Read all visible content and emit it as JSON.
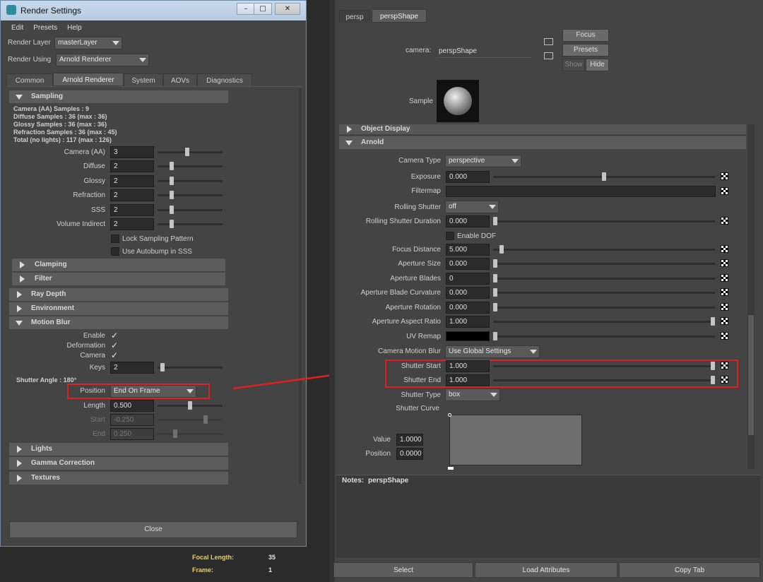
{
  "render_settings": {
    "title": "Render Settings",
    "menu": [
      "Edit",
      "Presets",
      "Help"
    ],
    "render_layer_label": "Render Layer",
    "render_layer_value": "masterLayer",
    "render_using_label": "Render Using",
    "render_using_value": "Arnold Renderer",
    "tabs": [
      "Common",
      "Arnold Renderer",
      "System",
      "AOVs",
      "Diagnostics"
    ],
    "active_tab": "Arnold Renderer",
    "sampling": {
      "header": "Sampling",
      "info": [
        "Camera (AA) Samples : 9",
        "Diffuse Samples : 36 (max : 36)",
        "Glossy Samples : 36 (max : 36)",
        "Refraction Samples : 36 (max : 45)",
        "Total (no lights) : 117 (max : 126)"
      ],
      "rows": [
        {
          "label": "Camera (AA)",
          "value": "3",
          "slider": 0.45
        },
        {
          "label": "Diffuse",
          "value": "2",
          "slider": 0.2
        },
        {
          "label": "Glossy",
          "value": "2",
          "slider": 0.2
        },
        {
          "label": "Refraction",
          "value": "2",
          "slider": 0.2
        },
        {
          "label": "SSS",
          "value": "2",
          "slider": 0.2
        },
        {
          "label": "Volume Indirect",
          "value": "2",
          "slider": 0.2
        }
      ],
      "lock_sampling_pattern": "Lock Sampling Pattern",
      "use_autobump": "Use Autobump in SSS"
    },
    "sections_collapsed_a": [
      "Clamping",
      "Filter",
      "Ray Depth",
      "Environment"
    ],
    "motion_blur": {
      "header": "Motion Blur",
      "enable_label": "Enable",
      "deformation_label": "Deformation",
      "camera_label": "Camera",
      "keys_label": "Keys",
      "keys_value": "2",
      "keys_slider": 0.05,
      "shutter_angle": "Shutter Angle : 180°",
      "position_label": "Position",
      "position_value": "End On Frame",
      "length_label": "Length",
      "length_value": "0.500",
      "length_slider": 0.5,
      "start_label": "Start",
      "start_value": "-0.250",
      "start_slider": 0.75,
      "end_label": "End",
      "end_value": "0.250",
      "end_slider": 0.25
    },
    "sections_collapsed_b": [
      "Lights",
      "Gamma Correction",
      "Textures"
    ],
    "close_label": "Close",
    "focal_length_label": "Focal Length:",
    "focal_length_value": "35",
    "frame_label": "Frame:",
    "frame_value": "1"
  },
  "attribute_editor": {
    "tabs": [
      "persp",
      "perspShape"
    ],
    "active_tab": "perspShape",
    "camera_label": "camera:",
    "camera_value": "perspShape",
    "focus_button": "Focus",
    "presets_button": "Presets",
    "show_button": "Show",
    "hide_button": "Hide",
    "sample_label": "Sample",
    "object_display_header": "Object Display",
    "arnold_header": "Arnold",
    "camera_type_label": "Camera Type",
    "camera_type_value": "perspective",
    "exposure_label": "Exposure",
    "exposure_value": "0.000",
    "exposure_slider": 0.5,
    "filtermap_label": "Filtermap",
    "rolling_shutter_label": "Rolling Shutter",
    "rolling_shutter_value": "off",
    "rolling_shutter_duration_label": "Rolling Shutter Duration",
    "rolling_shutter_duration_value": "0.000",
    "enable_dof_label": "Enable DOF",
    "rows": [
      {
        "label": "Focus Distance",
        "value": "5.000",
        "slider": 0.03
      },
      {
        "label": "Aperture Size",
        "value": "0.000",
        "slider": 0.0
      },
      {
        "label": "Aperture Blades",
        "value": "0",
        "slider": 0.0
      },
      {
        "label": "Aperture Blade Curvature",
        "value": "0.000",
        "slider": 0.0
      },
      {
        "label": "Aperture Rotation",
        "value": "0.000",
        "slider": 0.0
      },
      {
        "label": "Aperture Aspect Ratio",
        "value": "1.000",
        "slider": 1.0
      }
    ],
    "uv_remap_label": "UV Remap",
    "camera_motion_blur_label": "Camera Motion Blur",
    "camera_motion_blur_value": "Use Global Settings",
    "shutter_start_label": "Shutter Start",
    "shutter_start_value": "1.000",
    "shutter_end_label": "Shutter End",
    "shutter_end_value": "1.000",
    "shutter_type_label": "Shutter Type",
    "shutter_type_value": "box",
    "shutter_curve_label": "Shutter Curve",
    "value_label": "Value",
    "value_value": "1.0000",
    "position_label": "Position",
    "position_value": "0.0000",
    "notes_label": "Notes:",
    "notes_value": "perspShape",
    "bottom_buttons": [
      "Select",
      "Load Attributes",
      "Copy Tab"
    ]
  },
  "colors": {
    "highlight_box": "#e02020",
    "panel_bg": "#444444",
    "field_bg": "#2b2b2b",
    "yellow_text": "#f0d24a"
  }
}
